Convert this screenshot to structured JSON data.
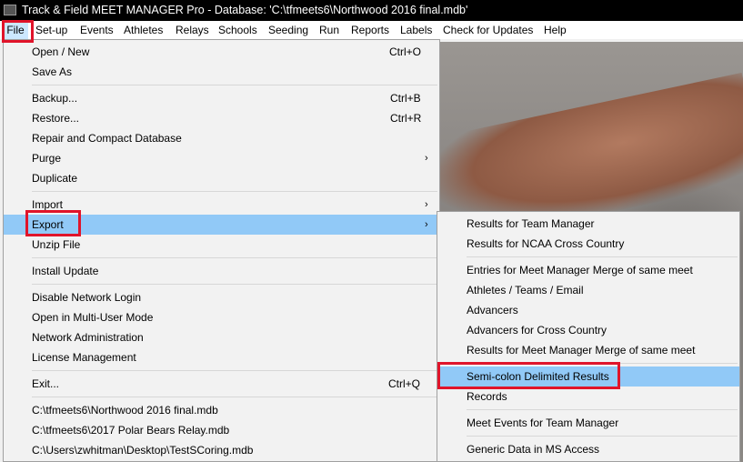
{
  "window": {
    "title": "Track & Field MEET MANAGER Pro - Database: 'C:\\tfmeets6\\Northwood 2016 final.mdb'"
  },
  "menubar": {
    "items": [
      "File",
      "Set-up",
      "Events",
      "Athletes",
      "Relays",
      "Schools",
      "Seeding",
      "Run",
      "Reports",
      "Labels",
      "Check for Updates",
      "Help"
    ],
    "active": "File"
  },
  "file_menu": {
    "open_new": {
      "label": "Open / New",
      "shortcut": "Ctrl+O"
    },
    "save_as": {
      "label": "Save As"
    },
    "backup": {
      "label": "Backup...",
      "shortcut": "Ctrl+B"
    },
    "restore": {
      "label": "Restore...",
      "shortcut": "Ctrl+R"
    },
    "repair": {
      "label": "Repair and Compact Database"
    },
    "purge": {
      "label": "Purge",
      "submenu": "›"
    },
    "duplicate": {
      "label": "Duplicate"
    },
    "import": {
      "label": "Import",
      "submenu": "›"
    },
    "export": {
      "label": "Export",
      "submenu": "›"
    },
    "unzip": {
      "label": "Unzip File"
    },
    "install_update": {
      "label": "Install Update"
    },
    "disable_network_login": {
      "label": "Disable Network Login"
    },
    "multi_user": {
      "label": "Open in Multi-User Mode"
    },
    "network_admin": {
      "label": "Network Administration"
    },
    "license": {
      "label": "License Management"
    },
    "exit": {
      "label": "Exit...",
      "shortcut": "Ctrl+Q"
    },
    "recent": [
      "C:\\tfmeets6\\Northwood 2016 final.mdb",
      "C:\\tfmeets6\\2017 Polar Bears Relay.mdb",
      "C:\\Users\\zwhitman\\Desktop\\TestSCoring.mdb"
    ]
  },
  "export_menu": {
    "items": [
      "Results for Team Manager",
      "Results for NCAA Cross Country",
      "Entries for Meet Manager Merge of same meet",
      "Athletes / Teams / Email",
      "Advancers",
      "Advancers for Cross Country",
      "Results for Meet Manager Merge of same meet",
      "Semi-colon Delimited Results",
      "Records",
      "Meet Events for Team Manager",
      "Generic Data in MS Access"
    ],
    "highlighted": "Semi-colon Delimited Results"
  },
  "colors": {
    "highlight": "#91c9f7",
    "annotation": "#e0142a",
    "titlebar": "#000000"
  }
}
